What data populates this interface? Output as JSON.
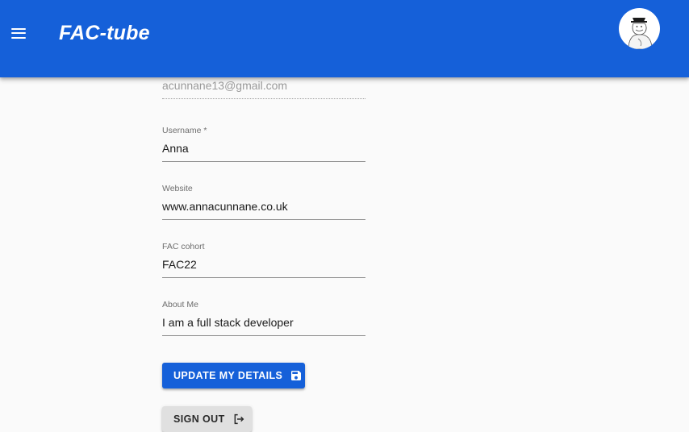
{
  "app": {
    "title": "FAC-tube",
    "menu_icon": "hamburger-menu-icon",
    "avatar_icon": "user-avatar-icon"
  },
  "form": {
    "email": {
      "label": "",
      "value": "acunnane13@gmail.com"
    },
    "username": {
      "label": "Username *",
      "value": "Anna"
    },
    "website": {
      "label": "Website",
      "value": "www.annacunnane.co.uk"
    },
    "cohort": {
      "label": "FAC cohort",
      "value": "FAC22"
    },
    "about": {
      "label": "About Me",
      "value": "I am a full stack developer"
    }
  },
  "actions": {
    "update_label": "UPDATE MY DETAILS",
    "update_icon": "save-icon",
    "signout_label": "SIGN OUT",
    "signout_icon": "logout-icon"
  },
  "colors": {
    "primary": "#1560d9",
    "background": "#fafafa",
    "secondary_button": "#e0e0e0"
  }
}
